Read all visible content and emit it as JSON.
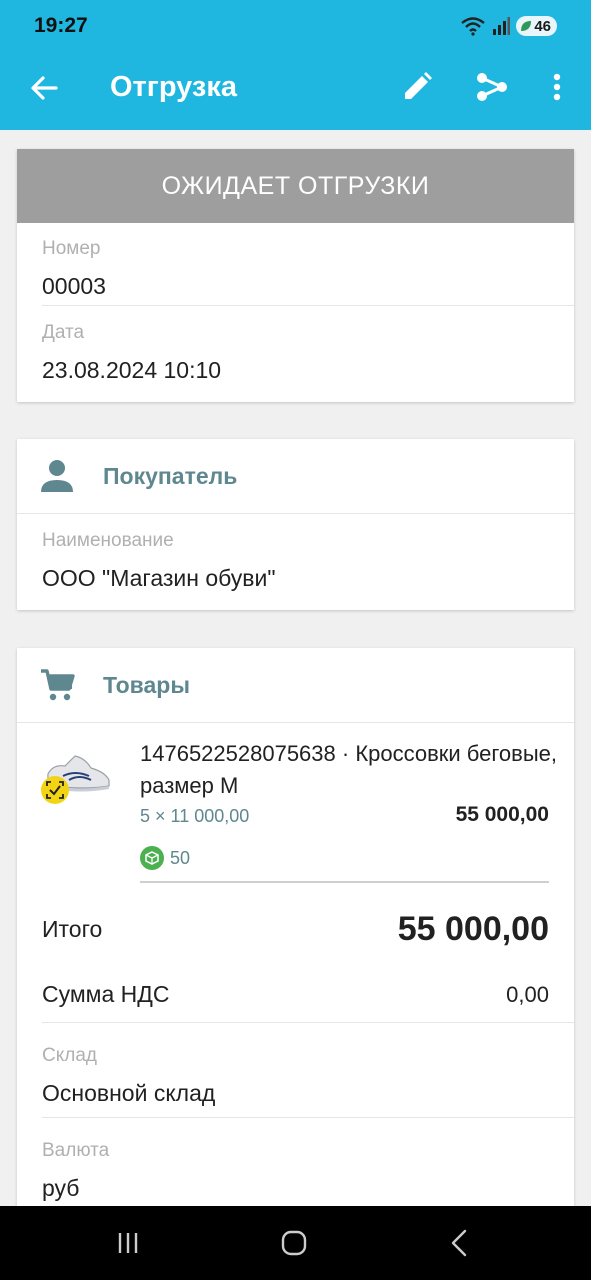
{
  "status_bar": {
    "time": "19:27",
    "battery": "46"
  },
  "app_bar": {
    "title": "Отгрузка"
  },
  "status_banner": "ОЖИДАЕТ ОТГРУЗКИ",
  "doc": {
    "number_label": "Номер",
    "number": "00003",
    "date_label": "Дата",
    "date": "23.08.2024 10:10"
  },
  "buyer": {
    "heading": "Покупатель",
    "name_label": "Наименование",
    "name": "ООО \"Магазин обуви\""
  },
  "goods": {
    "heading": "Товары",
    "items": [
      {
        "name": "1476522528075638 · Кроссовки беговые, размер M",
        "qty_price": "5 × 11 000,00",
        "sum": "55 000,00",
        "stock": "50"
      }
    ]
  },
  "totals": {
    "total_label": "Итого",
    "total": "55 000,00",
    "vat_label": "Сумма НДС",
    "vat": "0,00",
    "warehouse_label": "Склад",
    "warehouse": "Основной склад",
    "currency_label": "Валюта",
    "currency": "руб"
  },
  "colors": {
    "primary": "#1fb6e0",
    "banner": "#9e9e9e",
    "accent_text": "#5f8790",
    "stock_badge": "#4caf50",
    "mark_badge": "#f3d415"
  }
}
